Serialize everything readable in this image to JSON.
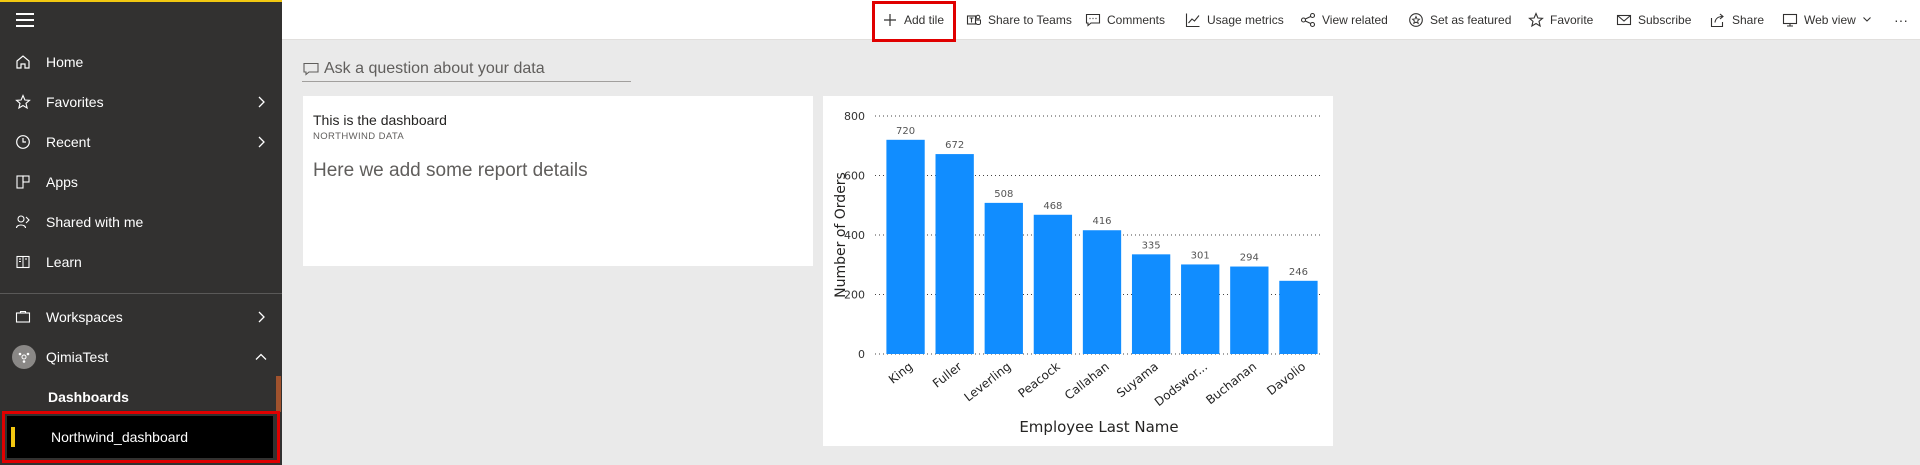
{
  "sidebar": {
    "items": [
      {
        "label": "Home"
      },
      {
        "label": "Favorites"
      },
      {
        "label": "Recent"
      },
      {
        "label": "Apps"
      },
      {
        "label": "Shared with me"
      },
      {
        "label": "Learn"
      },
      {
        "label": "Workspaces"
      },
      {
        "label": "QimiaTest"
      }
    ],
    "section_label": "Dashboards",
    "active_item": "Northwind_dashboard"
  },
  "toolbar": {
    "add_tile": "Add tile",
    "share_teams": "Share to Teams",
    "comments": "Comments",
    "usage_metrics": "Usage metrics",
    "view_related": "View related",
    "set_featured": "Set as featured",
    "favorite": "Favorite",
    "subscribe": "Subscribe",
    "share": "Share",
    "web_view": "Web view",
    "more": "···"
  },
  "qa": {
    "placeholder": "Ask a question about your data"
  },
  "text_tile": {
    "title": "This is the dashboard",
    "subtitle": "NORTHWIND DATA",
    "body": "Here we add some report details"
  },
  "colors": {
    "accent": "#f2c811",
    "bar": "#118dff",
    "highlight": "#e00000"
  },
  "chart_data": {
    "type": "bar",
    "categories": [
      "King",
      "Fuller",
      "Leverling",
      "Peacock",
      "Callahan",
      "Suyama",
      "Dodswor...",
      "Buchanan",
      "Davolio"
    ],
    "values": [
      720,
      672,
      508,
      468,
      416,
      335,
      301,
      294,
      246
    ],
    "xlabel": "Employee Last Name",
    "ylabel": "Number of Orders",
    "ylim": [
      0,
      800
    ],
    "yticks": [
      0,
      200,
      400,
      600,
      800
    ],
    "grid": true
  }
}
